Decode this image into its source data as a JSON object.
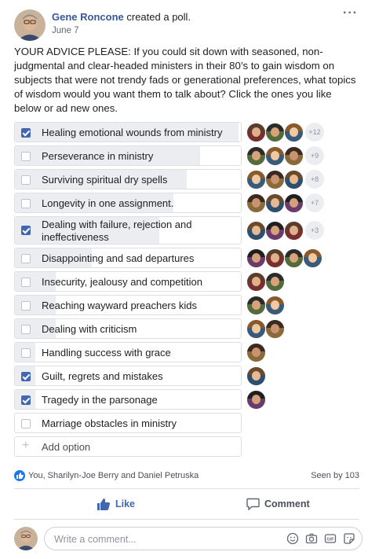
{
  "post": {
    "author": "Gene Roncone",
    "action": "created a poll.",
    "date": "June 7",
    "more_icon": "more-dots-icon",
    "text": "YOUR ADVICE PLEASE: If you could sit down with seasoned, non-judgmental and clear-headed ministers in their 80’s to gain wisdom on subjects that were not trendy fads or generational preferences, what topics of wisdom would you want them to talk about? Click the ones you like below or ad new ones."
  },
  "poll": {
    "options": [
      {
        "label": "Healing emotional wounds from ministry",
        "checked": true,
        "fill": 0.99,
        "voters": 3,
        "more": "+12"
      },
      {
        "label": "Perseverance in ministry",
        "checked": false,
        "fill": 0.82,
        "voters": 3,
        "more": "+9"
      },
      {
        "label": "Surviving spiritual dry spells",
        "checked": false,
        "fill": 0.76,
        "voters": 3,
        "more": "+8"
      },
      {
        "label": "Longevity in one assignment.",
        "checked": false,
        "fill": 0.7,
        "voters": 3,
        "more": "+7"
      },
      {
        "label": "Dealing with failure, rejection and ineffectiveness",
        "checked": true,
        "fill": 0.64,
        "voters": 3,
        "more": "+3"
      },
      {
        "label": "Disappointing and sad departures",
        "checked": false,
        "fill": 0.34,
        "voters": 4,
        "more": ""
      },
      {
        "label": "Insecurity, jealousy and competition",
        "checked": false,
        "fill": 0.18,
        "voters": 2,
        "more": ""
      },
      {
        "label": "Reaching wayward preachers kids",
        "checked": false,
        "fill": 0.18,
        "voters": 2,
        "more": ""
      },
      {
        "label": "Dealing with criticism",
        "checked": false,
        "fill": 0.18,
        "voters": 2,
        "more": ""
      },
      {
        "label": "Handling success with grace",
        "checked": false,
        "fill": 0.09,
        "voters": 1,
        "more": ""
      },
      {
        "label": "Guilt, regrets and mistakes",
        "checked": true,
        "fill": 0.09,
        "voters": 1,
        "more": ""
      },
      {
        "label": "Tragedy in the parsonage",
        "checked": true,
        "fill": 0.09,
        "voters": 1,
        "more": ""
      },
      {
        "label": "Marriage obstacles in ministry",
        "checked": false,
        "fill": 0.0,
        "voters": 0,
        "more": ""
      }
    ],
    "add_option_label": "Add option"
  },
  "reactions": {
    "icon": "like-reaction-icon",
    "names": "You, Sharilyn-Joe Berry and Daniel Petruska",
    "seen_by": "Seen by 103"
  },
  "actions": {
    "like_label": "Like",
    "comment_label": "Comment"
  },
  "comment": {
    "placeholder": "Write a comment..."
  },
  "colors": {
    "link": "#385898",
    "brand": "#4267b2",
    "fill": "#ebedf0"
  }
}
